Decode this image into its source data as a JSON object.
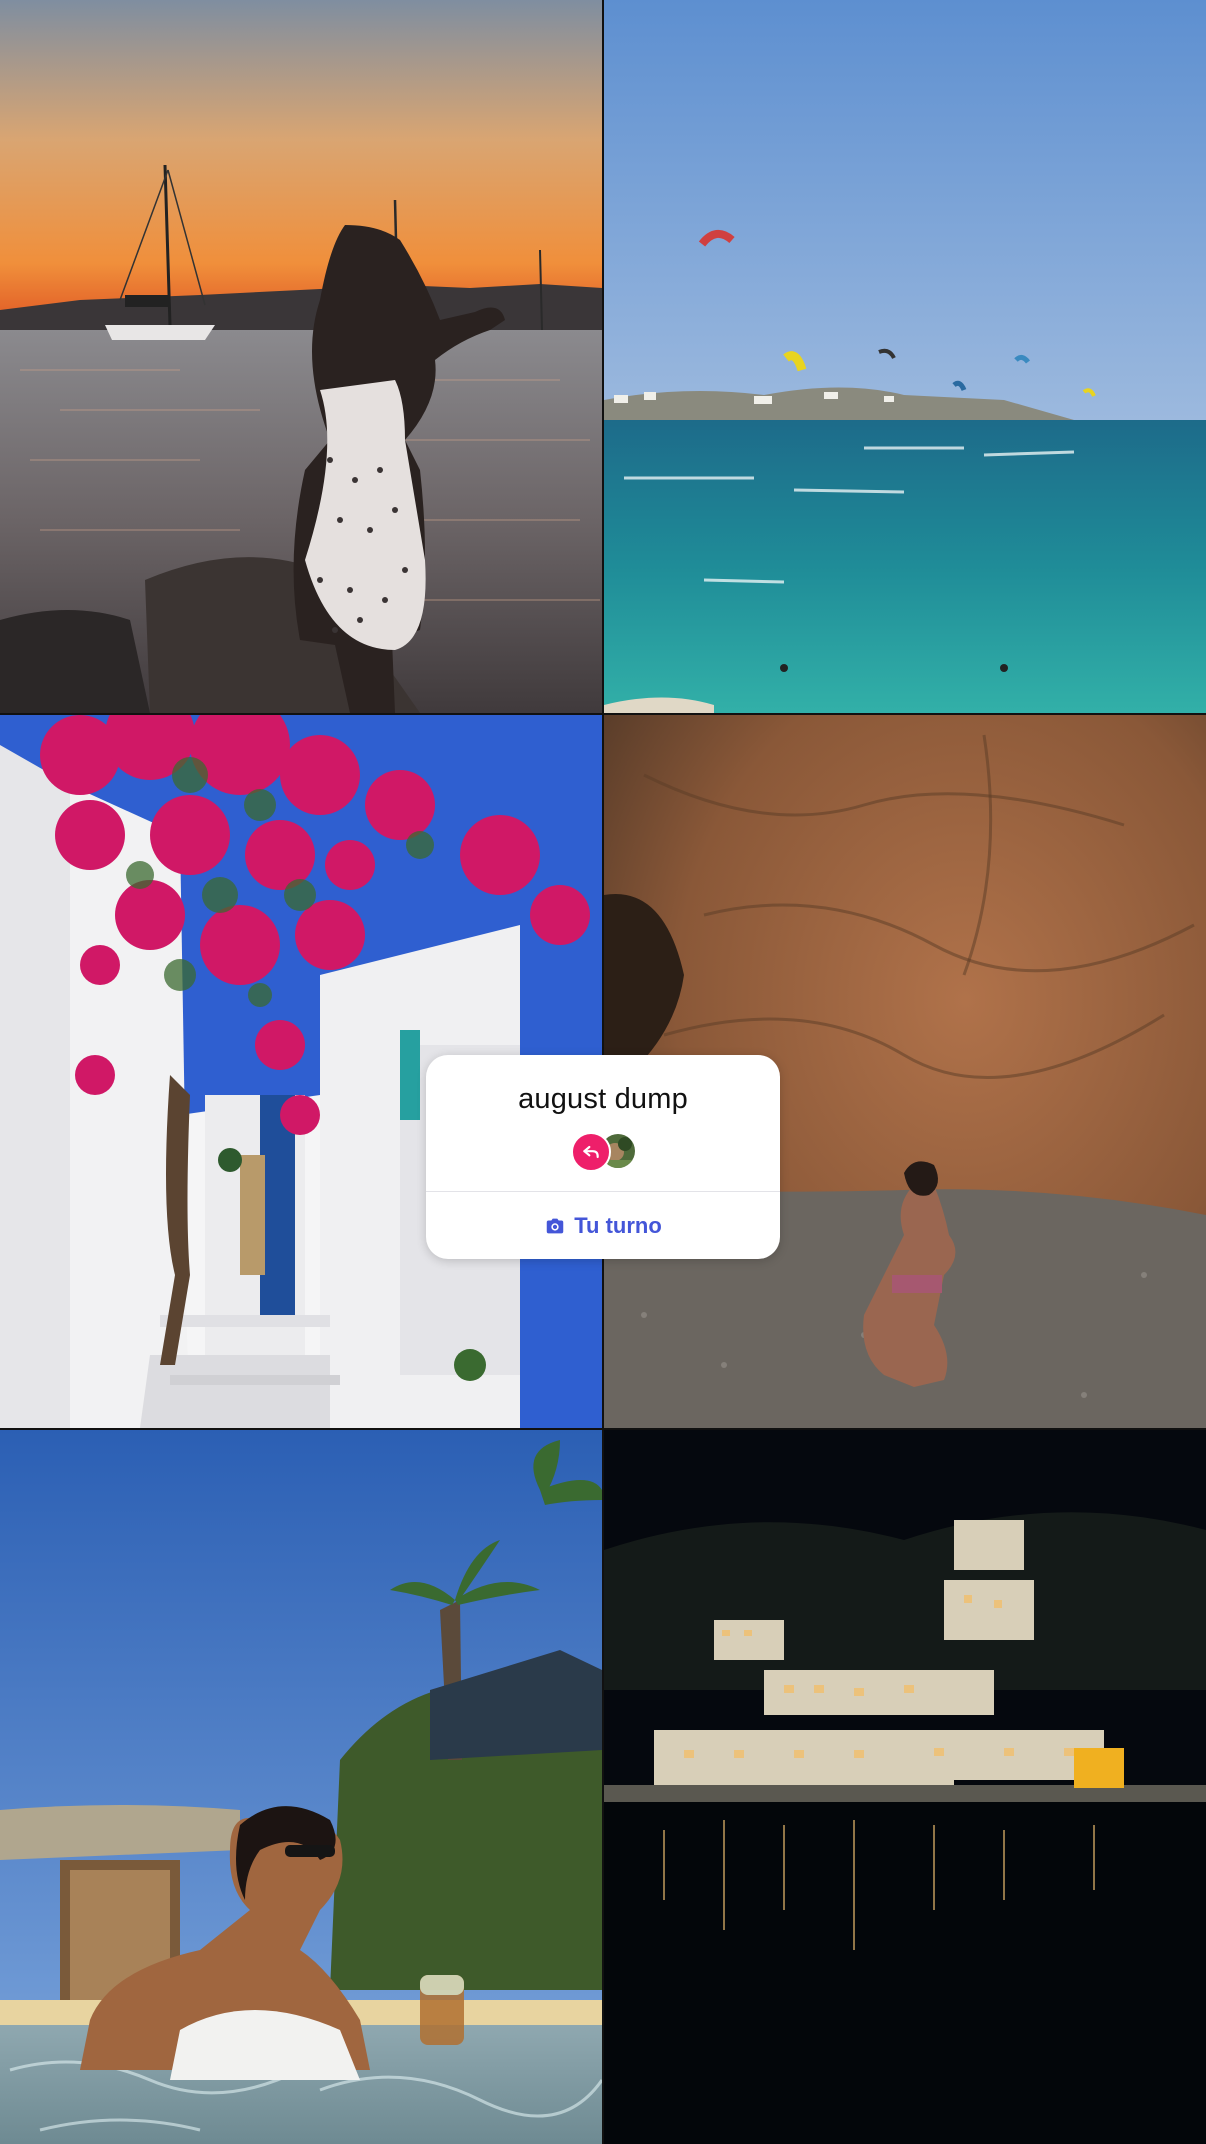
{
  "grid": {
    "photos": [
      {
        "icon": "sunset-harbor-photo"
      },
      {
        "icon": "kitesurf-beach-photo"
      },
      {
        "icon": "bougainvillea-street-photo"
      },
      {
        "icon": "sea-cave-photo"
      },
      {
        "icon": "pool-drink-photo"
      },
      {
        "icon": "night-harbor-photo"
      }
    ]
  },
  "card": {
    "title": "august dump",
    "action_label": "Tu turno",
    "action_icon": "camera-icon",
    "badge_icon": "reply-arrow-icon",
    "accent_color": "#ee1f6a",
    "action_color": "#4456d8"
  }
}
